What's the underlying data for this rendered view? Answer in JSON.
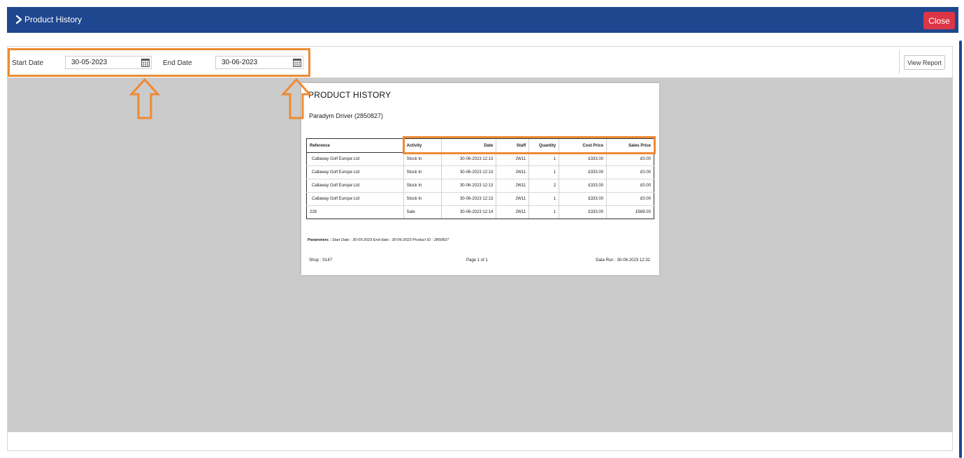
{
  "header": {
    "title": "Product History",
    "close_label": "Close"
  },
  "filters": {
    "start_label": "Start Date",
    "start_value": "30-05-2023",
    "end_label": "End Date",
    "end_value": "30-06-2023",
    "view_report_label": "View Report"
  },
  "report": {
    "title": "PRODUCT HISTORY",
    "product": "Paradym Driver (2850827)",
    "columns": [
      "Reference",
      "Activity",
      "Date",
      "Staff",
      "Quantity",
      "Cost Price",
      "Sales Price"
    ],
    "rows": [
      [
        "Callaway Golf Europe Ltd",
        "Stock In",
        "30-06-2023 12:13",
        "JW11",
        "1",
        "£333.00",
        "£0.00"
      ],
      [
        "Callaway Golf Europe Ltd",
        "Stock In",
        "30-06-2023 12:13",
        "JW11",
        "1",
        "£333.00",
        "£0.00"
      ],
      [
        "Callaway Golf Europe Ltd",
        "Stock In",
        "30-06-2023 12:13",
        "JW11",
        "2",
        "£333.00",
        "£0.00"
      ],
      [
        "Callaway Golf Europe Ltd",
        "Stock In",
        "30-06-2023 12:13",
        "JW11",
        "1",
        "£333.00",
        "£0.00"
      ],
      [
        "228",
        "Sale",
        "30-06-2023 12:14",
        "JW11",
        "1",
        "£333.00",
        "£569.00"
      ]
    ],
    "parameters_label": "Parameters :",
    "parameters_text": "Start Date : 30-05-2023 End date : 30-06-2023   Product ID : 2850827",
    "shop": "Shop : S147",
    "page": "Page 1  of  1",
    "data_run": "Data Run : 30-06-2023 12:32"
  },
  "colors": {
    "header_bg": "#1f478f",
    "close_bg": "#dc3545",
    "highlight": "#ee8a33",
    "viewer_bg": "#cbcbcb"
  },
  "icons": [
    "chevron-right-icon",
    "calendar-icon",
    "arrow-up-outline-icon"
  ]
}
